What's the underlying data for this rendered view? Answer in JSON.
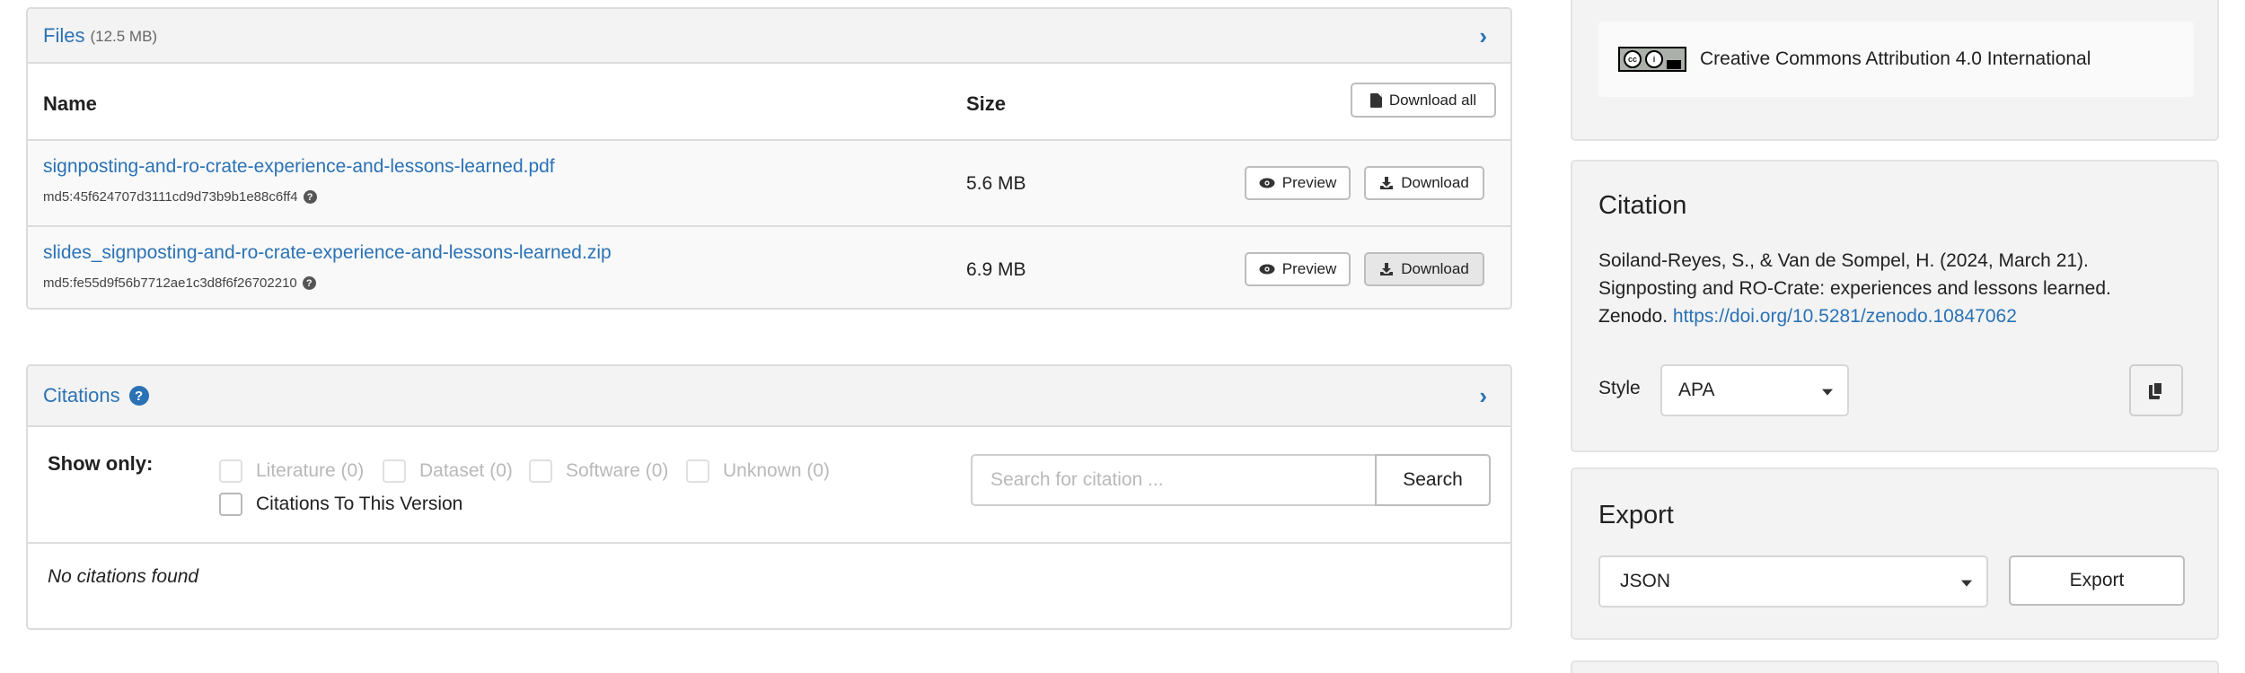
{
  "files": {
    "title": "Files",
    "total_size": "(12.5 MB)",
    "col_name": "Name",
    "col_size": "Size",
    "download_all_label": "Download all",
    "rows": [
      {
        "name": "signposting-and-ro-crate-experience-and-lessons-learned.pdf",
        "md5": "md5:45f624707d3111cd9d73b9b1e88c6ff4",
        "size": "5.6 MB",
        "preview_label": "Preview",
        "download_label": "Download"
      },
      {
        "name": "slides_signposting-and-ro-crate-experience-and-lessons-learned.zip",
        "md5": "md5:fe55d9f56b7712ae1c3d8f6f26702210",
        "size": "6.9 MB",
        "preview_label": "Preview",
        "download_label": "Download"
      }
    ]
  },
  "citations": {
    "title": "Citations",
    "show_only_label": "Show only:",
    "filters": [
      {
        "label": "Literature (0)",
        "enabled": false
      },
      {
        "label": "Dataset (0)",
        "enabled": false
      },
      {
        "label": "Software (0)",
        "enabled": false
      },
      {
        "label": "Unknown (0)",
        "enabled": false
      }
    ],
    "this_version_label": "Citations To This Version",
    "search_placeholder": "Search for citation ...",
    "search_button": "Search",
    "empty_message": "No citations found"
  },
  "license": {
    "name": "Creative Commons Attribution 4.0 International",
    "badge_text": "BY"
  },
  "citation_box": {
    "title": "Citation",
    "text_line1": "Soiland-Reyes, S., & Van de Sompel, H. (2024, March 21).",
    "text_line2": "Signposting and RO-Crate: experiences and lessons learned.",
    "text_line3_prefix": "Zenodo.",
    "doi": "https://doi.org/10.5281/zenodo.10847062",
    "style_label": "Style",
    "style_value": "APA"
  },
  "export": {
    "title": "Export",
    "format_value": "JSON",
    "button_label": "Export"
  },
  "colors": {
    "link": "#2a72b5",
    "panel_bg": "#f3f3f3",
    "border": "#dcdcdc"
  }
}
